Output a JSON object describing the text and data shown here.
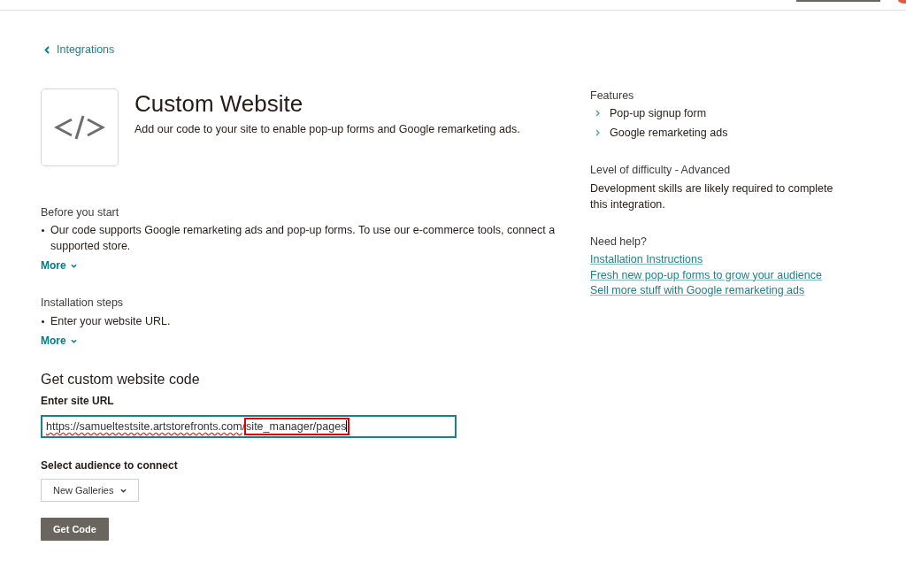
{
  "breadcrumb": {
    "label": "Integrations"
  },
  "integration": {
    "title": "Custom Website",
    "description": "Add our code to your site to enable pop-up forms and Google remarketing ads."
  },
  "sections": [
    {
      "heading": "Before you start",
      "bullets": [
        "Our code supports Google remarketing ads and pop-up forms. To use our e-commerce tools, connect a supported store."
      ],
      "more": {
        "label": "More",
        "expanded": false
      }
    },
    {
      "heading": "Installation steps",
      "bullets": [
        "Enter your website URL."
      ],
      "more": {
        "label": "More",
        "expanded": false
      }
    }
  ],
  "form": {
    "heading": "Get custom website code",
    "url_label": "Enter site URL",
    "url_field": {
      "focused": true,
      "value_parts": [
        {
          "text": "https://samueltestsite.artstorefronts.com",
          "misspelled": true,
          "highlighted": false
        },
        {
          "text": "/",
          "misspelled": false,
          "highlighted": false
        },
        {
          "text": "site_manager/pages",
          "misspelled": false,
          "highlighted": true
        }
      ]
    },
    "audience_label": "Select audience to connect",
    "audience_select": {
      "value": "New Galleries"
    },
    "submit_button": "Get Code"
  },
  "sidebar": {
    "features": {
      "heading": "Features",
      "items": [
        "Pop-up signup form",
        "Google remarketing ads"
      ]
    },
    "difficulty": {
      "heading": "Level of difficulty - Advanced",
      "description": "Development skills are likely required to complete this integration."
    },
    "help": {
      "heading": "Need help?",
      "links": [
        "Installation Instructions",
        "Fresh new pop-up forms to grow your audience",
        "Sell more stuff with Google remarketing ads"
      ]
    }
  }
}
